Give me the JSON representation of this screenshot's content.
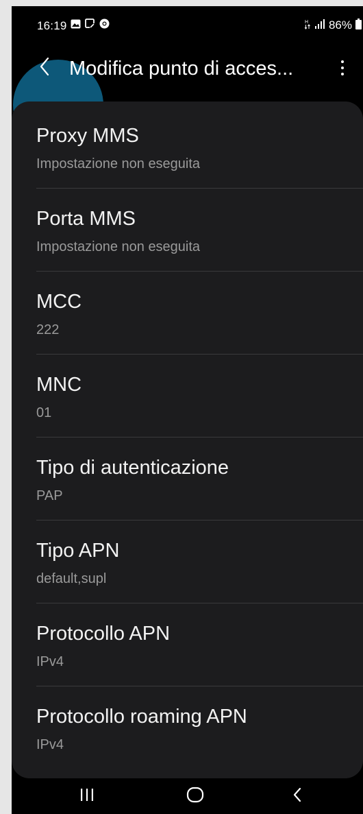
{
  "status_bar": {
    "time": "16:19",
    "battery": "86%",
    "left_icons": [
      "gallery-icon",
      "screenshot-icon",
      "chrome-icon"
    ],
    "right_icons": [
      "lte-data-icon",
      "signal-icon",
      "battery-icon"
    ]
  },
  "app_bar": {
    "title": "Modifica punto di acces...",
    "back_icon": "chevron-left-icon",
    "more_icon": "more-vert-icon"
  },
  "settings": {
    "items": [
      {
        "title": "Proxy MMS",
        "value": "Impostazione non eseguita"
      },
      {
        "title": "Porta MMS",
        "value": "Impostazione non eseguita"
      },
      {
        "title": "MCC",
        "value": "222"
      },
      {
        "title": "MNC",
        "value": "01"
      },
      {
        "title": "Tipo di autenticazione",
        "value": "PAP"
      },
      {
        "title": "Tipo APN",
        "value": "default,supl"
      },
      {
        "title": "Protocollo APN",
        "value": "IPv4"
      },
      {
        "title": "Protocollo roaming APN",
        "value": "IPv4"
      }
    ]
  },
  "nav_bar": {
    "buttons": [
      "recents-icon",
      "home-icon",
      "back-icon"
    ]
  },
  "colors": {
    "background": "#000000",
    "card": "#1c1c1e",
    "title_text": "#f2f2f2",
    "secondary_text": "#9a9a9a",
    "touch_highlight": "#0e5d7f"
  }
}
